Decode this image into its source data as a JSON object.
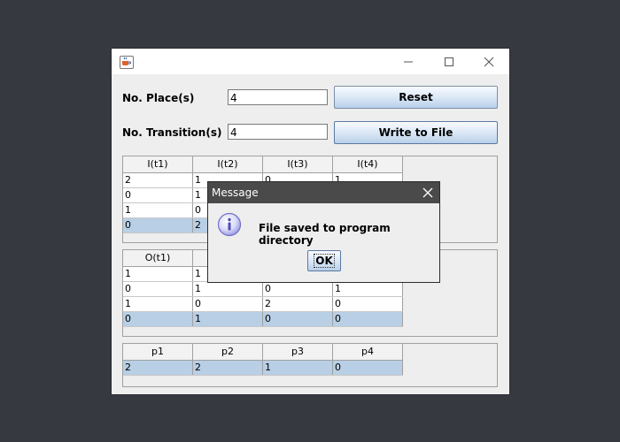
{
  "window": {
    "app_icon": "java-cup-icon",
    "controls": [
      "minimize-icon",
      "maximize-icon",
      "close-icon"
    ]
  },
  "form": {
    "places_label": "No. Place(s)",
    "places_value": "4",
    "transitions_label": "No. Transition(s)",
    "transitions_value": "4",
    "reset_label": "Reset",
    "write_label": "Write to File"
  },
  "input_table": {
    "headers": [
      "I(t1)",
      "I(t2)",
      "I(t3)",
      "I(t4)"
    ],
    "rows": [
      [
        "2",
        "1",
        "0",
        "1"
      ],
      [
        "0",
        "1",
        "",
        ""
      ],
      [
        "1",
        "0",
        "",
        ""
      ],
      [
        "0",
        "2",
        "",
        ""
      ]
    ]
  },
  "output_table": {
    "headers": [
      "O(t1)",
      "",
      "",
      ""
    ],
    "rows": [
      [
        "1",
        "1",
        "",
        ""
      ],
      [
        "0",
        "1",
        "0",
        "1"
      ],
      [
        "1",
        "0",
        "2",
        "0"
      ],
      [
        "0",
        "1",
        "0",
        "0"
      ]
    ]
  },
  "marking_table": {
    "headers": [
      "p1",
      "p2",
      "p3",
      "p4"
    ],
    "rows": [
      [
        "2",
        "2",
        "1",
        "0"
      ]
    ]
  },
  "dialog": {
    "title": "Message",
    "message": "File saved to program directory",
    "ok_label": "OK",
    "icon": "info-icon"
  }
}
